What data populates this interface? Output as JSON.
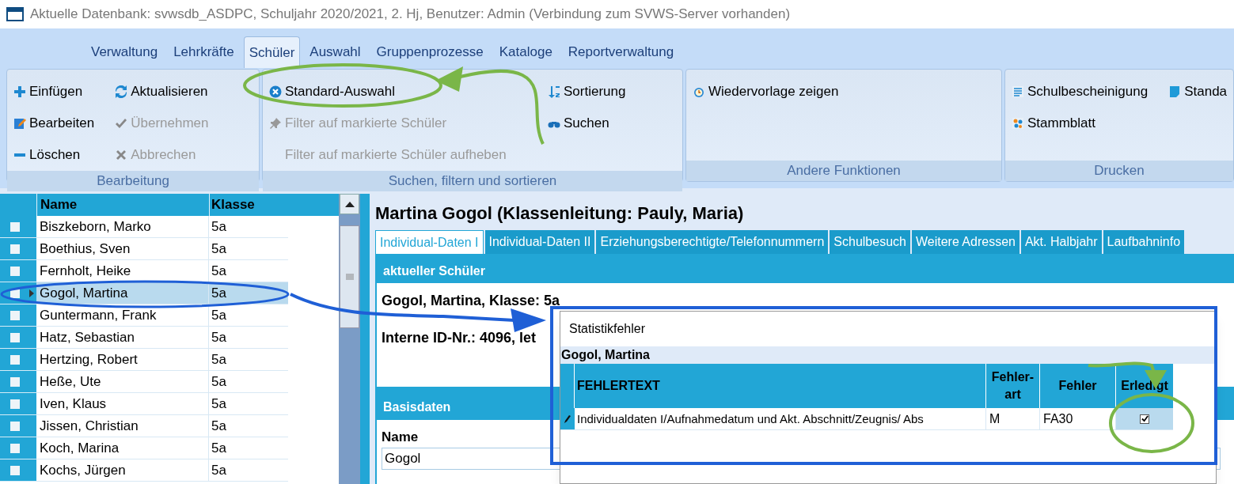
{
  "window": {
    "title": "Aktuelle Datenbank: svwsdb_ASDPC, Schuljahr 2020/2021, 2. Hj, Benutzer: Admin (Verbindung zum SVWS-Server vorhanden)"
  },
  "ribbon": {
    "tabs": [
      {
        "label": "Verwaltung",
        "selected": false
      },
      {
        "label": "Lehrkräfte",
        "selected": false
      },
      {
        "label": "Schüler",
        "selected": true
      },
      {
        "label": "Auswahl",
        "selected": false
      },
      {
        "label": "Gruppenprozesse",
        "selected": false
      },
      {
        "label": "Kataloge",
        "selected": false
      },
      {
        "label": "Reportverwaltung",
        "selected": false
      }
    ],
    "groups": [
      {
        "title": "Bearbeitung",
        "columns": [
          [
            {
              "label": "Einfügen",
              "disabled": false
            },
            {
              "label": "Bearbeiten",
              "disabled": false
            },
            {
              "label": "Löschen",
              "disabled": false
            }
          ],
          [
            {
              "label": "Aktualisieren",
              "disabled": false
            },
            {
              "label": "Übernehmen",
              "disabled": true
            },
            {
              "label": "Abbrechen",
              "disabled": true
            }
          ]
        ]
      },
      {
        "title": "Suchen, filtern und sortieren",
        "columns": [
          [
            {
              "label": "Standard-Auswahl",
              "disabled": false
            },
            {
              "label": "Filter auf markierte Schüler",
              "disabled": true
            },
            {
              "label": "Filter auf markierte Schüler aufheben",
              "disabled": true
            }
          ],
          [
            {
              "label": "Sortierung",
              "disabled": false
            },
            {
              "label": "Suchen",
              "disabled": false
            }
          ]
        ]
      },
      {
        "title": "Andere Funktionen",
        "columns": [
          [
            {
              "label": "Wiedervorlage zeigen",
              "disabled": false
            }
          ]
        ]
      },
      {
        "title": "Drucken",
        "columns": [
          [
            {
              "label": "Schulbescheinigung",
              "disabled": false
            },
            {
              "label": "Stammblatt",
              "disabled": false
            }
          ],
          [
            {
              "label": "Standa",
              "disabled": false
            }
          ]
        ]
      }
    ]
  },
  "student_list": {
    "columns": [
      "Name",
      "Klasse"
    ],
    "rows": [
      {
        "name": "Biszkeborn, Marko",
        "klasse": "5a",
        "selected": false,
        "checked": false
      },
      {
        "name": "Boethius, Sven",
        "klasse": "5a",
        "selected": false,
        "checked": false
      },
      {
        "name": "Fernholt, Heike",
        "klasse": "5a",
        "selected": false,
        "checked": false
      },
      {
        "name": "Gogol, Martina",
        "klasse": "5a",
        "selected": true,
        "checked": false
      },
      {
        "name": "Guntermann, Frank",
        "klasse": "5a",
        "selected": false,
        "checked": false
      },
      {
        "name": "Hatz, Sebastian",
        "klasse": "5a",
        "selected": false,
        "checked": false
      },
      {
        "name": "Hertzing, Robert",
        "klasse": "5a",
        "selected": false,
        "checked": false
      },
      {
        "name": "Heße, Ute",
        "klasse": "5a",
        "selected": false,
        "checked": false
      },
      {
        "name": "Iven, Klaus",
        "klasse": "5a",
        "selected": false,
        "checked": false
      },
      {
        "name": "Jissen, Christian",
        "klasse": "5a",
        "selected": false,
        "checked": false
      },
      {
        "name": "Koch, Marina",
        "klasse": "5a",
        "selected": false,
        "checked": false
      },
      {
        "name": "Kochs, Jürgen",
        "klasse": "5a",
        "selected": false,
        "checked": false
      }
    ]
  },
  "detail": {
    "title": "Martina Gogol (Klassenleitung: Pauly, Maria)",
    "tabs": [
      {
        "label": "Individual-Daten I",
        "selected": true
      },
      {
        "label": "Individual-Daten II",
        "selected": false
      },
      {
        "label": "Erziehungsberechtigte/Telefonnummern",
        "selected": false
      },
      {
        "label": "Schulbesuch",
        "selected": false
      },
      {
        "label": "Weitere Adressen",
        "selected": false
      },
      {
        "label": "Akt. Halbjahr",
        "selected": false
      },
      {
        "label": "Laufbahninfo",
        "selected": false
      }
    ],
    "current_header": "aktueller Schüler",
    "current_lines": [
      "Gogol, Martina, Klasse: 5a",
      "Interne ID-Nr.: 4096, let"
    ],
    "basis_header": "Basisdaten",
    "name_label": "Name",
    "name_value": "Gogol"
  },
  "dialog": {
    "title": "Statistikfehler",
    "subject": "Gogol, Martina",
    "columns": [
      "FEHLERTEXT",
      "Fehler-art",
      "Fehler",
      "Erledigt"
    ],
    "rows": [
      {
        "fehlertext": "Individualdaten I/Aufnahmedatum und Akt. Abschnitt/Zeugnis/ Abs",
        "fehlerart": "M",
        "fehler": "FA30",
        "erledigt": true,
        "selected": true
      }
    ]
  }
}
